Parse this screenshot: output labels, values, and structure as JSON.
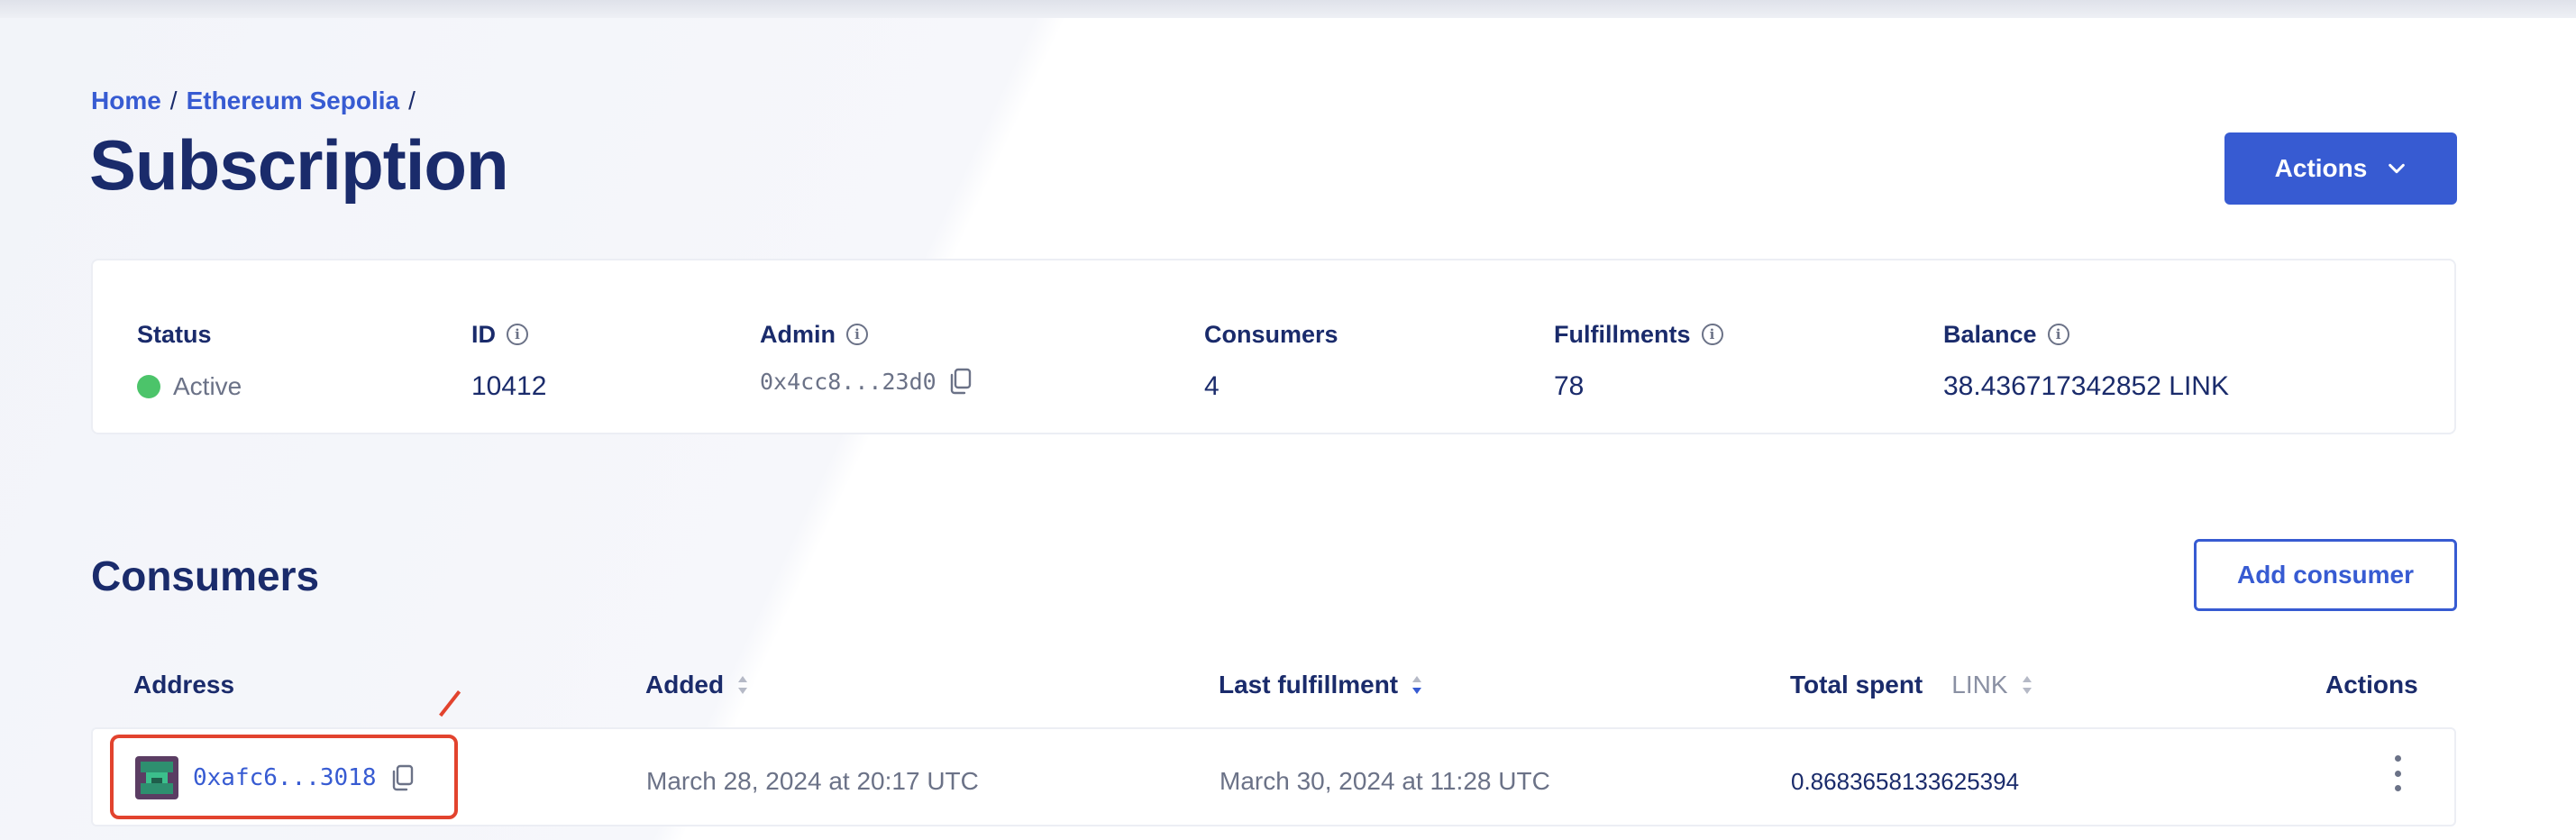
{
  "breadcrumb": {
    "items": [
      "Home",
      "Ethereum Sepolia"
    ],
    "separator": "/"
  },
  "page_title": "Subscription",
  "header": {
    "actions_label": "Actions"
  },
  "summary": {
    "status": {
      "label": "Status",
      "value": "Active",
      "color": "#4cc46a"
    },
    "id": {
      "label": "ID",
      "value": "10412"
    },
    "admin": {
      "label": "Admin",
      "value": "0x4cc8...23d0"
    },
    "consumers": {
      "label": "Consumers",
      "value": "4"
    },
    "fulfillments": {
      "label": "Fulfillments",
      "value": "78"
    },
    "balance": {
      "label": "Balance",
      "value": "38.436717342852 LINK"
    }
  },
  "consumers_section": {
    "title": "Consumers",
    "add_button": "Add consumer",
    "columns": {
      "address": "Address",
      "added": "Added",
      "last_fulfillment": "Last fulfillment",
      "total_spent": "Total spent",
      "total_spent_unit": "LINK",
      "actions": "Actions"
    },
    "rows": [
      {
        "address": "0xafc6...3018",
        "added": "March 28, 2024 at 20:17 UTC",
        "last_fulfillment": "March 30, 2024 at 11:28 UTC",
        "total_spent": "0.8683658133625394"
      }
    ]
  },
  "colors": {
    "primary": "#375bd2",
    "heading": "#1a2b6b",
    "muted": "#6b7287",
    "annotation": "#e2432e"
  },
  "icons": [
    "info-icon",
    "copy-icon",
    "chevron-down-icon",
    "sort-icon",
    "kebab-menu-icon",
    "avatar"
  ]
}
